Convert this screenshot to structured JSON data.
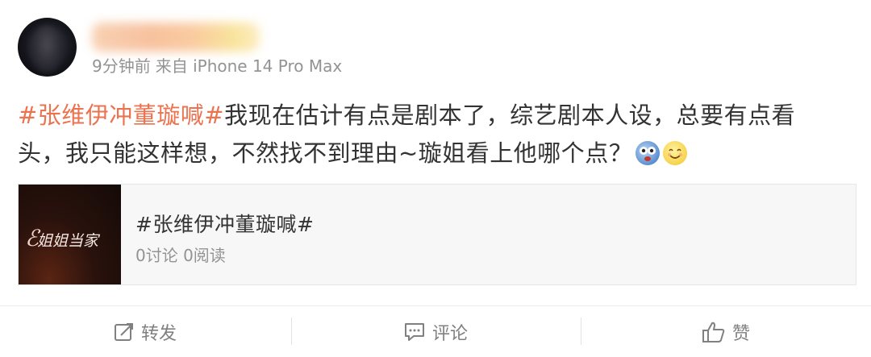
{
  "post": {
    "time": "9分钟前",
    "source": "来自 iPhone 14 Pro Max",
    "topic": "#张维伊冲董璇喊#",
    "text": "我现在估计有点是剧本了，综艺剧本人设，总要有点看头，我只能这样想，不然找不到理由~璇姐看上他哪个点？",
    "emojis": [
      "drool-emoji",
      "smile-emoji"
    ]
  },
  "card": {
    "thumb_logo": "姐姐当家",
    "title": "#张维伊冲董璇喊#",
    "stats": "0讨论 0阅读"
  },
  "actions": {
    "repost": "转发",
    "comment": "评论",
    "like": "赞"
  },
  "colors": {
    "topic": "#eb7350",
    "meta": "#939393",
    "action": "#808080",
    "card_bg": "#f7f7f7"
  }
}
